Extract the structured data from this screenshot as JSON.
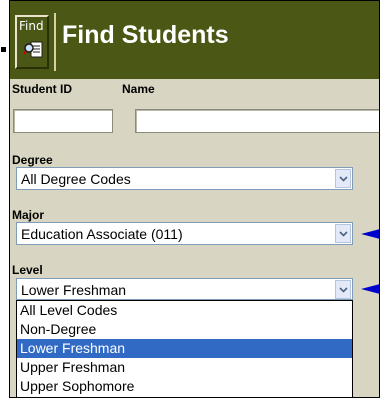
{
  "header": {
    "find_button_label": "Find",
    "title": "Find Students"
  },
  "fields": {
    "student_id_label": "Student ID",
    "student_id_value": "",
    "name_label": "Name",
    "name_value": "",
    "degree_label": "Degree",
    "degree_value": "All Degree Codes",
    "major_label": "Major",
    "major_value": "Education Associate (011)",
    "level_label": "Level",
    "level_value": "Lower Freshman"
  },
  "level_options": [
    "All Level Codes",
    "Non-Degree",
    "Lower Freshman",
    "Upper Freshman",
    "Upper Sophomore"
  ],
  "level_selected_index": 2,
  "colors": {
    "header_bg": "#4b5714",
    "form_bg": "#d8d6c2",
    "selection": "#316ac5",
    "pointer_arrow": "#0000cc"
  },
  "icons": [
    "find-icon",
    "dropdown-arrow-icon",
    "pointer-arrow-icon"
  ]
}
